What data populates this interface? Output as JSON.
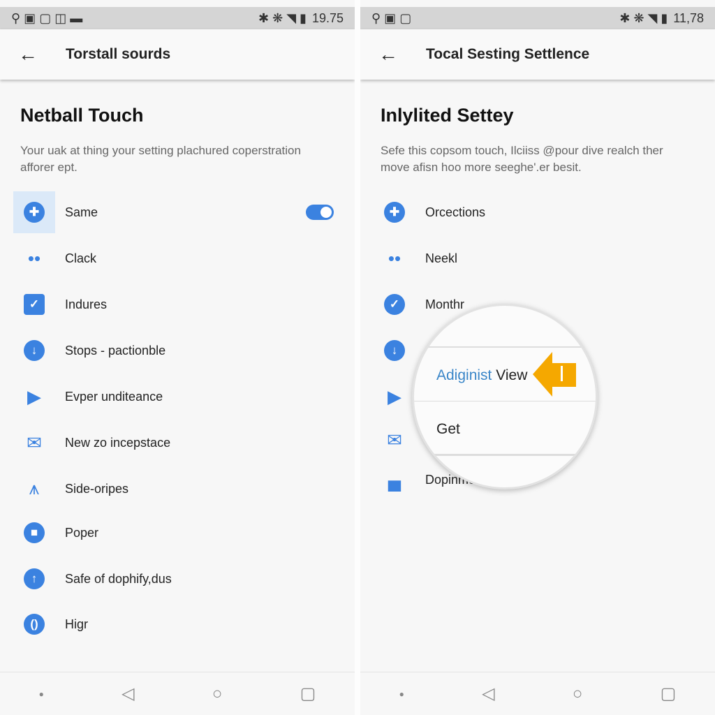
{
  "left": {
    "status_time": "19.75",
    "title": "Torstall sourds",
    "heading": "Netball Touch",
    "description": "Your uak at thing your setting plachured coperstration afforer ept.",
    "items": [
      {
        "label": "Same",
        "icon": "compass-icon",
        "toggle": true
      },
      {
        "label": "Clack",
        "icon": "people-icon"
      },
      {
        "label": "Indures",
        "icon": "checkbox-icon"
      },
      {
        "label": "Stops - pactionble",
        "icon": "download-icon"
      },
      {
        "label": "Evper unditeance",
        "icon": "play-icon"
      },
      {
        "label": "New zo incepstace",
        "icon": "mail-icon"
      },
      {
        "label": "Side-oripes",
        "icon": "antenna-icon"
      },
      {
        "label": "Poper",
        "icon": "square-circle-icon"
      },
      {
        "label": "Safe of dophify,dus",
        "icon": "up-arrow-circle-icon"
      },
      {
        "label": "Higr",
        "icon": "bracket-circle-icon"
      }
    ]
  },
  "right": {
    "status_time": "11,78",
    "title": "Tocal Sesting Settlence",
    "heading": "Inlylited Settey",
    "description": "Sefe this copsom touch, Ilciiss @pour dive realch ther move afisn hoo more seeghe'.er besit.",
    "items": [
      {
        "label": "Orcections",
        "icon": "compass-icon"
      },
      {
        "label": "Neekl",
        "icon": "people-icon"
      },
      {
        "label": "Monthr",
        "icon": "check-circle-icon"
      },
      {
        "label": "",
        "icon": "download-icon"
      },
      {
        "label": "",
        "icon": "play-icon"
      },
      {
        "label": "",
        "icon": "mail-icon"
      },
      {
        "label": "Dopinmee",
        "icon": "store-icon"
      }
    ],
    "popup": {
      "item1_blue": "Adiginist",
      "item1_black": "View",
      "item2": "Get"
    }
  },
  "colors": {
    "accent": "#3b82e0",
    "arrow": "#f5a800"
  }
}
